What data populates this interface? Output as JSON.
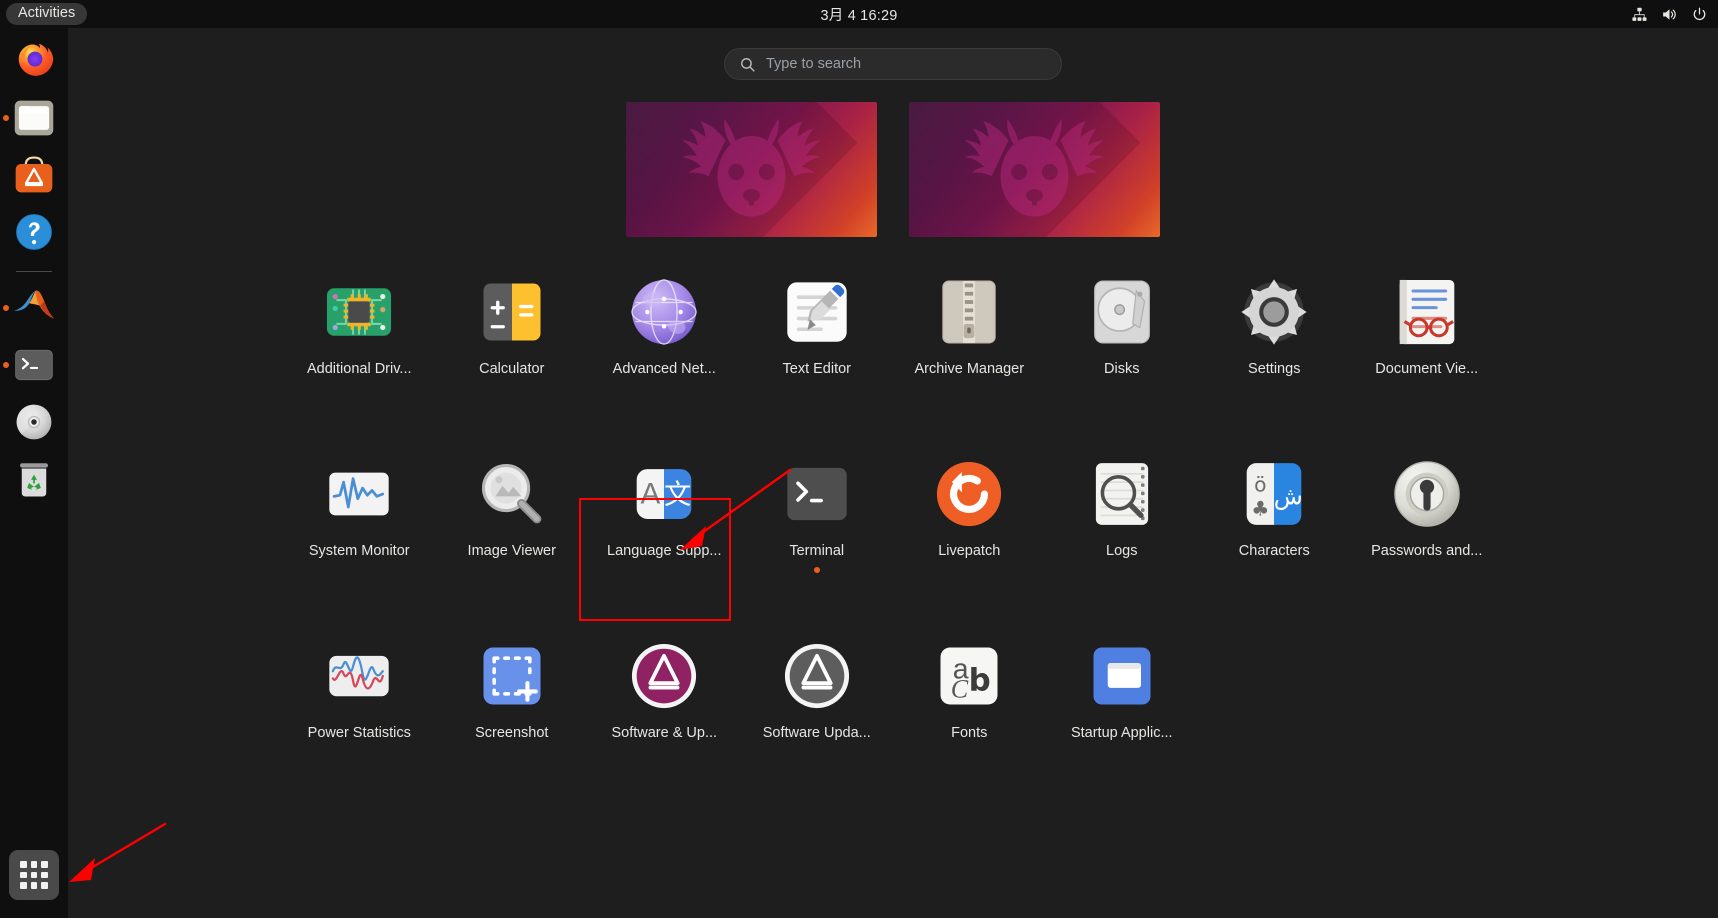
{
  "topbar": {
    "activities_label": "Activities",
    "clock": "3月 4  16:29",
    "tray": [
      {
        "name": "network-icon",
        "label": "Network"
      },
      {
        "name": "volume-icon",
        "label": "Volume"
      },
      {
        "name": "power-icon",
        "label": "Power"
      }
    ]
  },
  "search": {
    "placeholder": "Type to search",
    "value": "",
    "icon": "search-icon"
  },
  "dock": {
    "items": [
      {
        "name": "firefox",
        "label": "Firefox Web Browser",
        "running": false
      },
      {
        "name": "files",
        "label": "Files",
        "running": true
      },
      {
        "name": "ubuntu-software",
        "label": "Ubuntu Software",
        "running": false
      },
      {
        "name": "help",
        "label": "Help",
        "running": false
      },
      {
        "name": "matlab",
        "label": "MATLAB",
        "running": true
      },
      {
        "name": "terminal",
        "label": "Terminal",
        "running": true
      },
      {
        "name": "disc",
        "label": "CD/DVD Drive",
        "running": false
      },
      {
        "name": "trash",
        "label": "Trash",
        "running": false
      }
    ],
    "show_apps_label": "Show Applications"
  },
  "workspaces": [
    {
      "name": "workspace-1",
      "active": true
    },
    {
      "name": "workspace-2",
      "active": false
    }
  ],
  "apps": [
    {
      "label": "Additional Driv...",
      "icon": "additional-drivers",
      "running": false,
      "highlighted": false
    },
    {
      "label": "Calculator",
      "icon": "calculator",
      "running": false,
      "highlighted": false
    },
    {
      "label": "Advanced Net...",
      "icon": "advanced-network",
      "running": false,
      "highlighted": false
    },
    {
      "label": "Text Editor",
      "icon": "text-editor",
      "running": false,
      "highlighted": false
    },
    {
      "label": "Archive Manager",
      "icon": "archive-manager",
      "running": false,
      "highlighted": false
    },
    {
      "label": "Disks",
      "icon": "disks",
      "running": false,
      "highlighted": false
    },
    {
      "label": "Settings",
      "icon": "settings",
      "running": false,
      "highlighted": false
    },
    {
      "label": "Document Vie...",
      "icon": "document-viewer",
      "running": false,
      "highlighted": false
    },
    {
      "label": "System Monitor",
      "icon": "system-monitor",
      "running": false,
      "highlighted": false
    },
    {
      "label": "Image Viewer",
      "icon": "image-viewer",
      "running": false,
      "highlighted": false
    },
    {
      "label": "Language Supp...",
      "icon": "language-support",
      "running": false,
      "highlighted": true
    },
    {
      "label": "Terminal",
      "icon": "terminal",
      "running": true,
      "highlighted": false
    },
    {
      "label": "Livepatch",
      "icon": "livepatch",
      "running": false,
      "highlighted": false
    },
    {
      "label": "Logs",
      "icon": "logs",
      "running": false,
      "highlighted": false
    },
    {
      "label": "Characters",
      "icon": "characters",
      "running": false,
      "highlighted": false
    },
    {
      "label": "Passwords and...",
      "icon": "passwords-and-keys",
      "running": false,
      "highlighted": false
    },
    {
      "label": "Power Statistics",
      "icon": "power-statistics",
      "running": false,
      "highlighted": false
    },
    {
      "label": "Screenshot",
      "icon": "screenshot",
      "running": false,
      "highlighted": false
    },
    {
      "label": "Software & Up...",
      "icon": "software-and-updates",
      "running": false,
      "highlighted": false
    },
    {
      "label": "Software Upda...",
      "icon": "software-updater",
      "running": false,
      "highlighted": false
    },
    {
      "label": "Fonts",
      "icon": "fonts",
      "running": false,
      "highlighted": false
    },
    {
      "label": "Startup Applic...",
      "icon": "startup-applications",
      "running": false,
      "highlighted": false
    }
  ],
  "annotations": {
    "highlight_color": "#ff0000",
    "arrow_to_language_support": "arrow pointing to Language Support icon",
    "arrow_to_show_apps": "arrow pointing to Show Applications button"
  },
  "colors": {
    "background": "#1e1e1e",
    "topbar": "#0f0f0f",
    "dock": "#100f0f",
    "accent": "#e8601c",
    "text": "#e8e6e3",
    "placeholder": "#9aa0a6"
  }
}
